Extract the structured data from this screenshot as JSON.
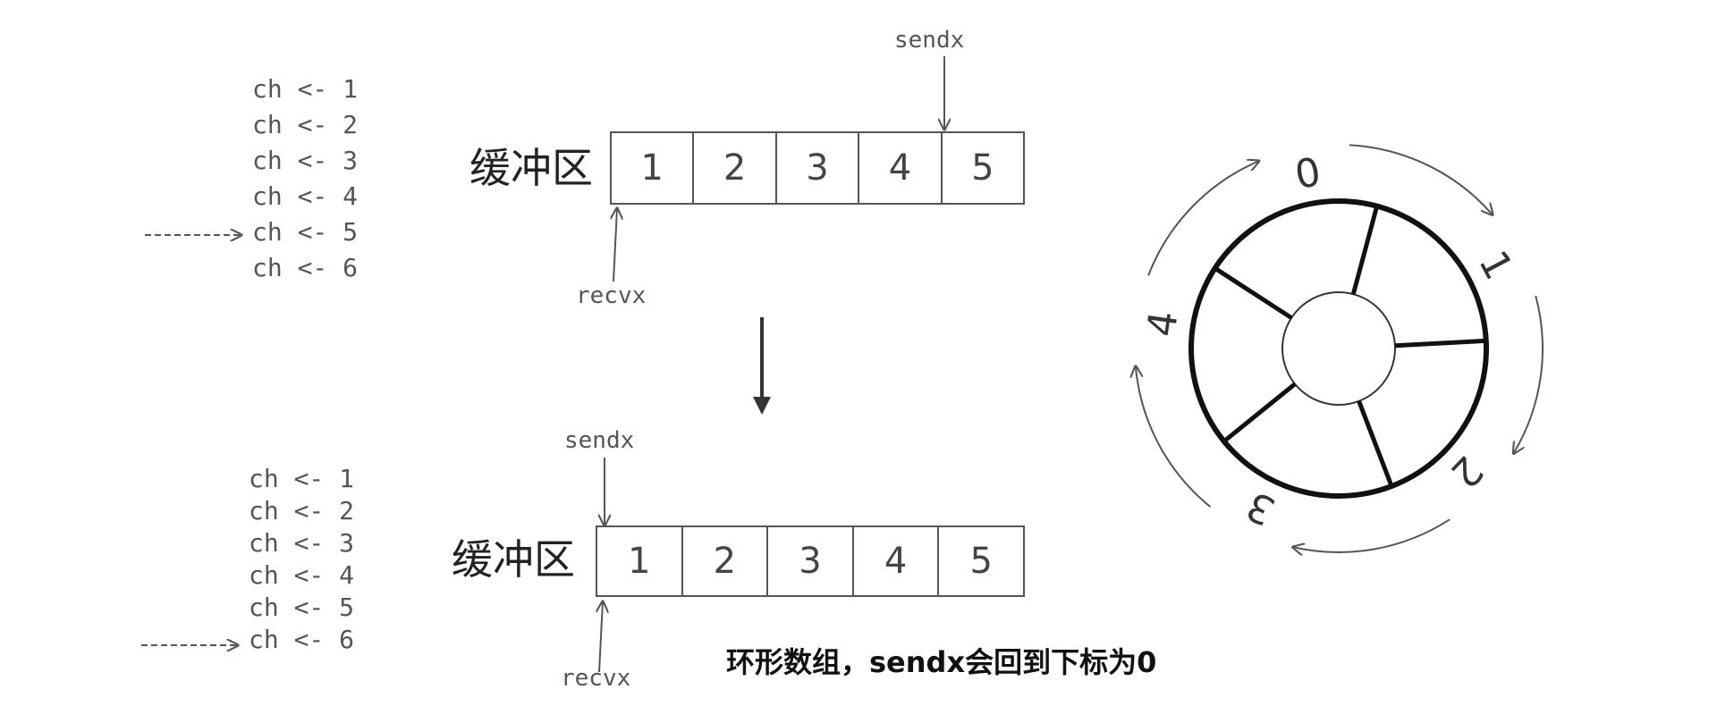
{
  "top": {
    "sends": [
      "ch <- 1",
      "ch <- 2",
      "ch <- 3",
      "ch <- 4",
      "ch <- 5",
      "ch <- 6"
    ],
    "current_index": 4,
    "buffer_label": "缓冲区",
    "buffer": [
      "1",
      "2",
      "3",
      "4",
      "5"
    ],
    "sendx_label": "sendx",
    "recvx_label": "recvx"
  },
  "bottom": {
    "sends": [
      "ch <- 1",
      "ch <- 2",
      "ch <- 3",
      "ch <- 4",
      "ch <- 5",
      "ch <- 6"
    ],
    "current_index": 5,
    "buffer_label": "缓冲区",
    "buffer": [
      "1",
      "2",
      "3",
      "4",
      "5"
    ],
    "sendx_label": "sendx",
    "recvx_label": "recvx"
  },
  "ring": {
    "slots": [
      "0",
      "1",
      "2",
      "3",
      "4"
    ],
    "direction": "clockwise"
  },
  "caption": "环形数组，sendx会回到下标为0",
  "colors": {
    "stroke": "#555555",
    "ring": "#111111"
  }
}
